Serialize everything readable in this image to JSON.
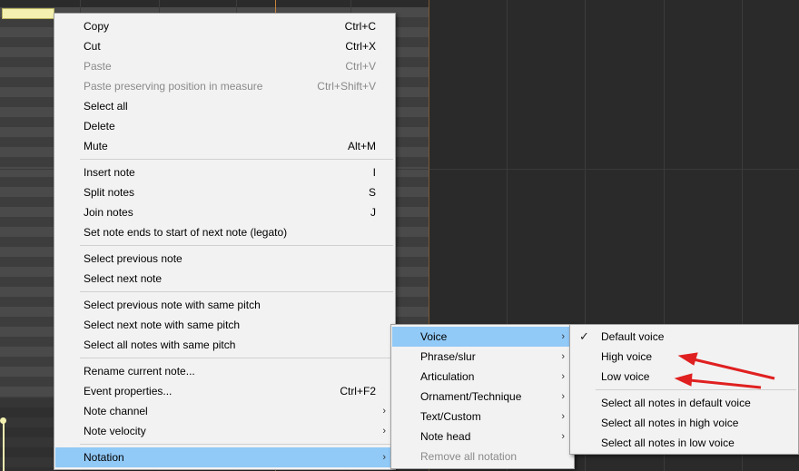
{
  "context_menu": {
    "items": [
      {
        "label": "Copy",
        "shortcut": "Ctrl+C"
      },
      {
        "label": "Cut",
        "shortcut": "Ctrl+X"
      },
      {
        "label": "Paste",
        "shortcut": "Ctrl+V"
      },
      {
        "label": "Paste preserving position in measure",
        "shortcut": "Ctrl+Shift+V"
      },
      {
        "label": "Select all",
        "shortcut": ""
      },
      {
        "label": "Delete",
        "shortcut": ""
      },
      {
        "label": "Mute",
        "shortcut": "Alt+M"
      },
      {
        "label": "Insert note",
        "shortcut": "I"
      },
      {
        "label": "Split notes",
        "shortcut": "S"
      },
      {
        "label": "Join notes",
        "shortcut": "J"
      },
      {
        "label": "Set note ends to start of next note (legato)",
        "shortcut": ""
      },
      {
        "label": "Select previous note",
        "shortcut": ""
      },
      {
        "label": "Select next note",
        "shortcut": ""
      },
      {
        "label": "Select previous note with same pitch",
        "shortcut": ""
      },
      {
        "label": "Select next note with same pitch",
        "shortcut": ""
      },
      {
        "label": "Select all notes with same pitch",
        "shortcut": ""
      },
      {
        "label": "Rename current note...",
        "shortcut": ""
      },
      {
        "label": "Event properties...",
        "shortcut": "Ctrl+F2"
      },
      {
        "label": "Note channel",
        "shortcut": ""
      },
      {
        "label": "Note velocity",
        "shortcut": ""
      },
      {
        "label": "Notation",
        "shortcut": ""
      }
    ]
  },
  "notation_submenu": {
    "items": [
      {
        "label": "Voice"
      },
      {
        "label": "Phrase/slur"
      },
      {
        "label": "Articulation"
      },
      {
        "label": "Ornament/Technique"
      },
      {
        "label": "Text/Custom"
      },
      {
        "label": "Note head"
      },
      {
        "label": "Remove all notation"
      }
    ]
  },
  "voice_submenu": {
    "items": [
      {
        "label": "Default voice",
        "checked": true
      },
      {
        "label": "High voice"
      },
      {
        "label": "Low voice"
      },
      {
        "label": "Select all notes in default voice"
      },
      {
        "label": "Select all notes in high voice"
      },
      {
        "label": "Select all notes in low voice"
      }
    ]
  },
  "glyphs": {
    "submenu_arrow": "›",
    "check": "✓"
  },
  "colors": {
    "highlight": "#91c9f7",
    "annotation_arrow": "#e02020",
    "note": "#f3f0b0"
  }
}
